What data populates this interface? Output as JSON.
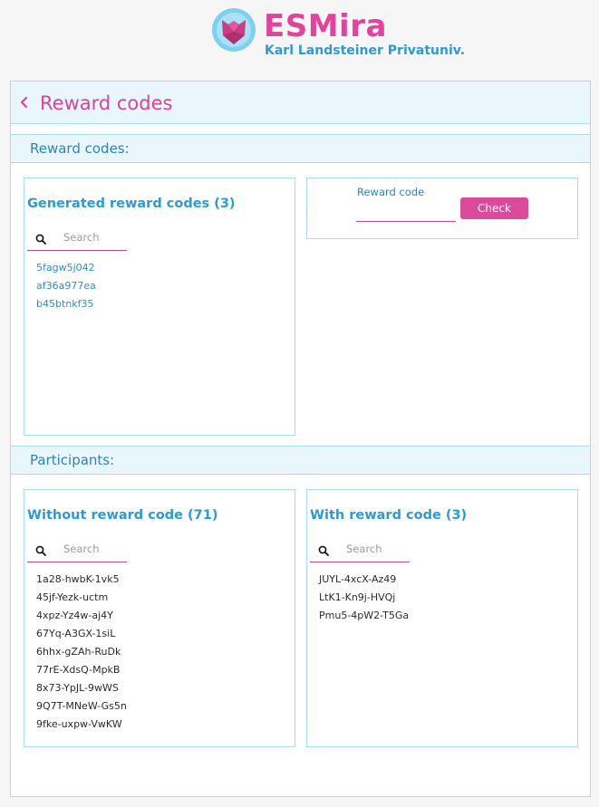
{
  "brand": {
    "name": "ESMira",
    "subtitle": "Karl Landsteiner Privatuniv.",
    "primary_color": "#e0449c",
    "secondary_color": "#2d9bd0"
  },
  "page": {
    "title": "Reward codes",
    "back_icon": "chevron-left-icon"
  },
  "sections": {
    "reward_codes_label": "Reward codes:",
    "participants_label": "Participants:"
  },
  "generated_codes": {
    "title": "Generated reward codes (3)",
    "search_placeholder": "Search",
    "items": [
      "5fagw5j042",
      "af36a977ea",
      "b45btnkf35"
    ]
  },
  "reward_check": {
    "label": "Reward code",
    "value": "",
    "button_label": "Check"
  },
  "without_code": {
    "title": "Without reward code (71)",
    "search_placeholder": "Search",
    "items": [
      "1a28-hwbK-1vk5",
      "45jf-Yezk-uctm",
      "4xpz-Yz4w-aj4Y",
      "67Yq-A3GX-1siL",
      "6hhx-gZAh-RuDk",
      "77rE-XdsQ-MpkB",
      "8x73-YpJL-9wWS",
      "9Q7T-MNeW-Gs5n",
      "9fke-uxpw-VwKW"
    ]
  },
  "with_code": {
    "title": "With reward code (3)",
    "search_placeholder": "Search",
    "items": [
      "JUYL-4xcX-Az49",
      "LtK1-Kn9j-HVQj",
      "Pmu5-4pW2-T5Ga"
    ]
  }
}
